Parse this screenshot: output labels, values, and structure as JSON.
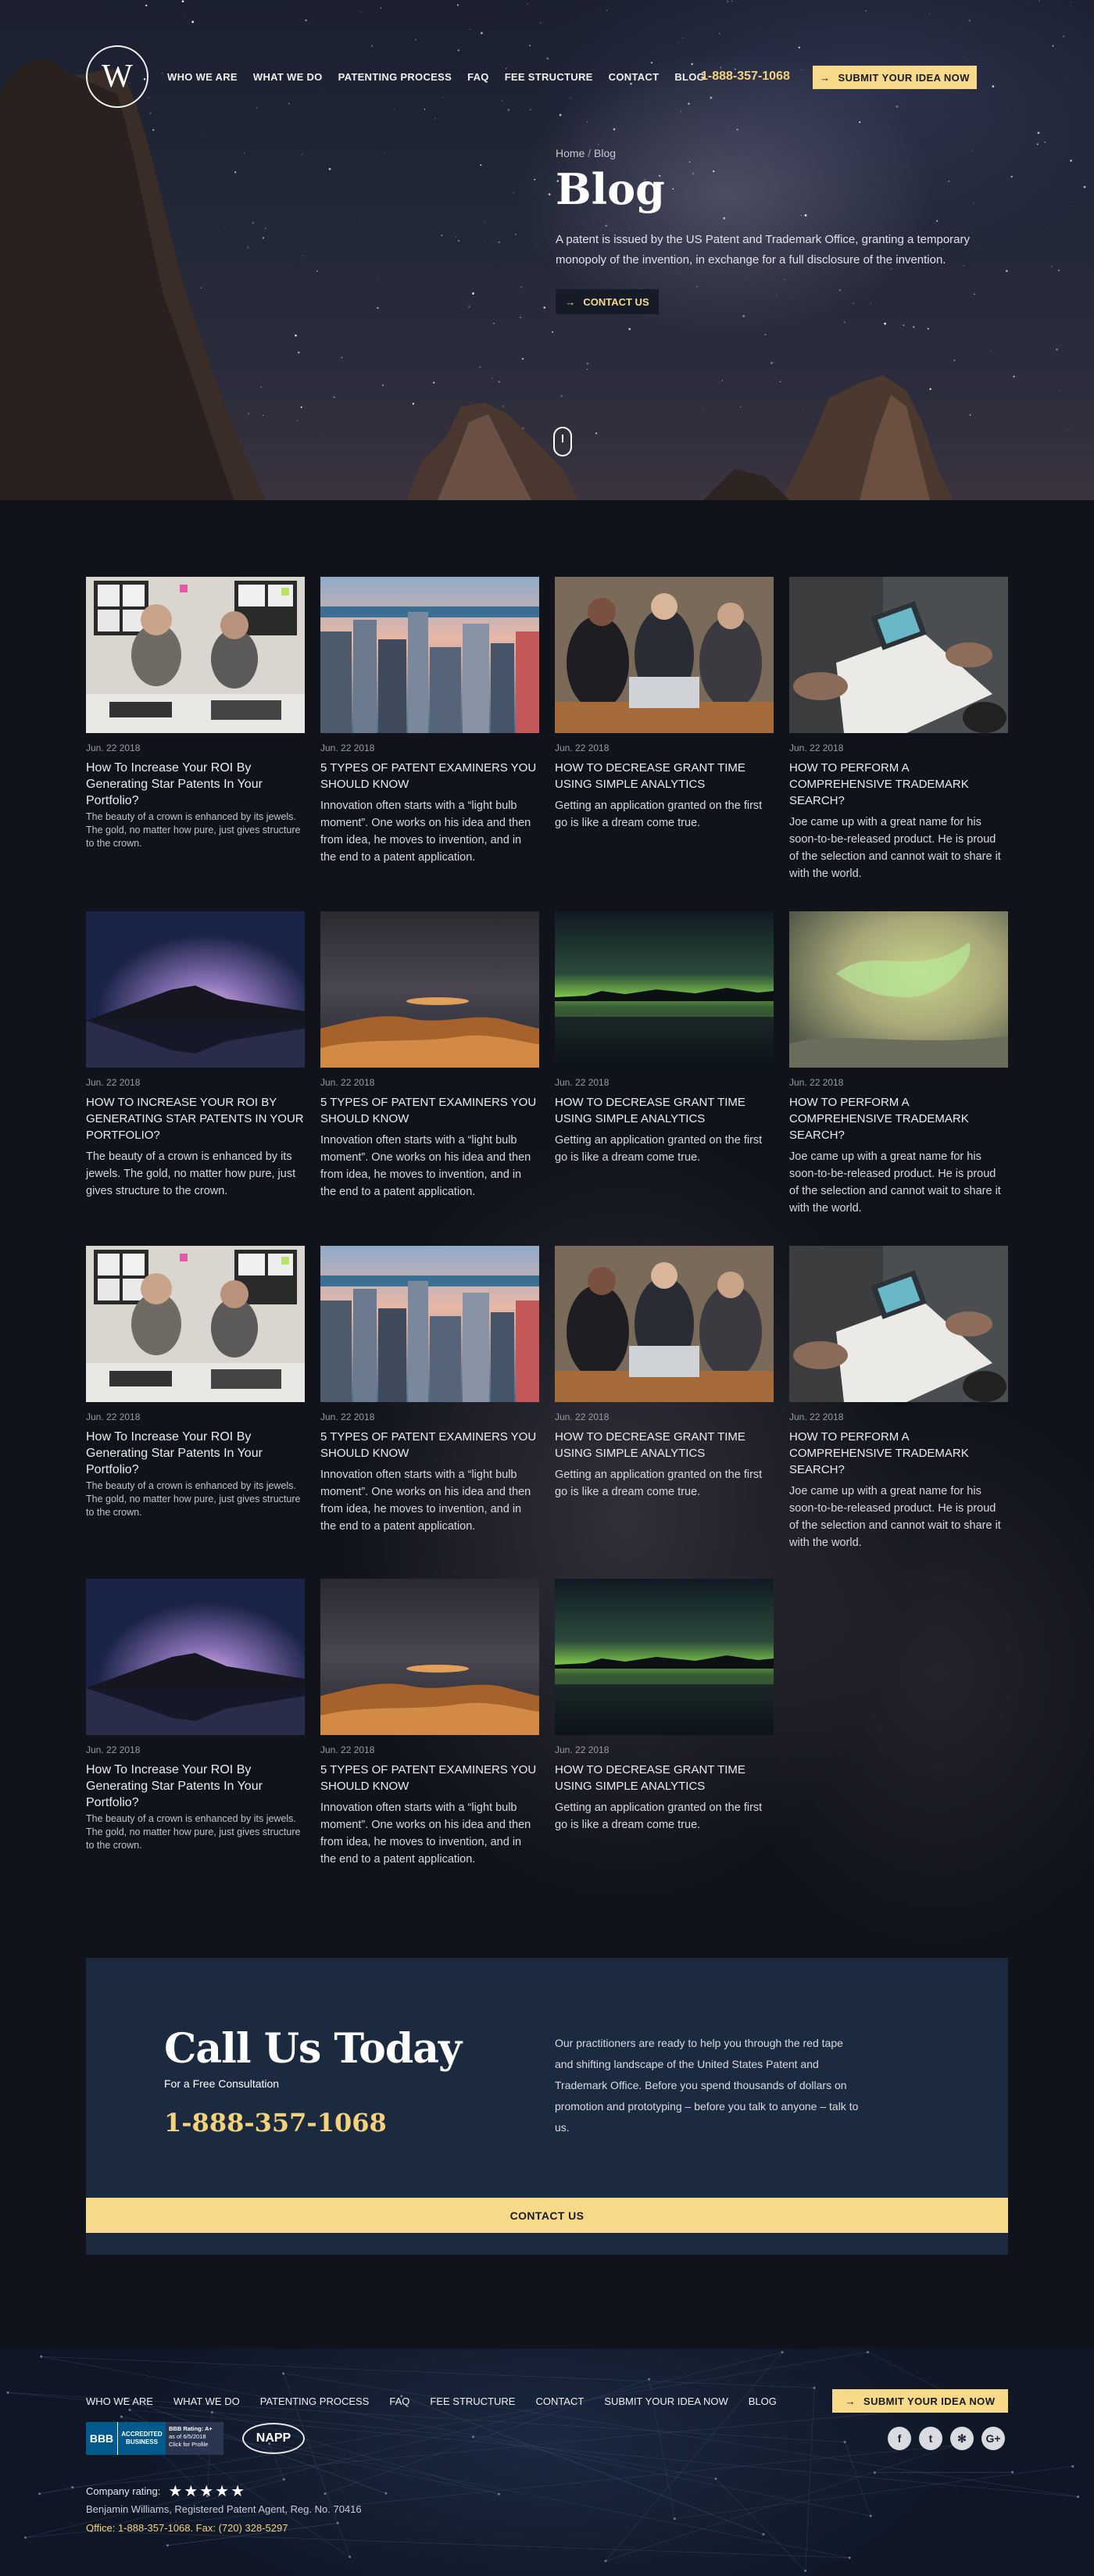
{
  "header": {
    "logo_text": "W",
    "nav": [
      "WHO WE ARE",
      "WHAT WE DO",
      "PATENTING PROCESS",
      "FAQ",
      "FEE STRUCTURE",
      "CONTACT",
      "BLOG"
    ],
    "phone": "1-888-357-1068",
    "submit_label": "SUBMIT YOUR IDEA NOW",
    "arrow": "→"
  },
  "hero": {
    "breadcrumb_home": "Home",
    "breadcrumb_sep": "/",
    "breadcrumb_current": "Blog",
    "title": "Blog",
    "description": "A patent is issued by the US Patent and Trademark Office, granting a temporary monopoly of the invention, in exchange for a full disclosure of the invention.",
    "contact_label": "CONTACT US"
  },
  "posts": [
    {
      "img": "office",
      "date": "Jun. 22 2018",
      "title": "How To Increase Your ROI By Generating Star Patents In Your Portfolio?",
      "excerpt": "The beauty of a crown is enhanced by its jewels. The gold, no matter how pure, just gives structure to the crown.",
      "style": "sentence"
    },
    {
      "img": "city",
      "date": "Jun. 22 2018",
      "title": "5 TYPES OF PATENT EXAMINERS YOU SHOULD KNOW",
      "excerpt": "Innovation often starts with a “light bulb moment”. One works on his idea and then from idea, he moves to invention, and in the end to a patent application.",
      "style": "caps"
    },
    {
      "img": "meeting",
      "date": "Jun. 22 2018",
      "title": "HOW TO DECREASE GRANT TIME USING SIMPLE ANALYTICS",
      "excerpt": "Getting an application granted on the first go is like a dream come true.",
      "style": "caps"
    },
    {
      "img": "desk",
      "date": "Jun. 22 2018",
      "title": "HOW TO PERFORM A COMPREHENSIVE TRADEMARK SEARCH?",
      "excerpt": "Joe came up with a great name for his soon-to-be-released product. He is proud of the selection and cannot wait to share it with the world.",
      "style": "caps"
    },
    {
      "img": "lake",
      "date": "Jun. 22 2018",
      "title": "HOW TO INCREASE YOUR ROI BY GENERATING STAR PATENTS IN YOUR PORTFOLIO?",
      "excerpt": "The beauty of a crown is enhanced by its jewels. The gold, no matter how pure, just gives structure to the crown.",
      "style": "caps"
    },
    {
      "img": "desert",
      "date": "Jun. 22 2018",
      "title": "5 TYPES OF PATENT EXAMINERS YOU SHOULD KNOW",
      "excerpt": "Innovation often starts with a “light bulb moment”. One works on his idea and then from idea, he moves to invention, and in the end to a patent application.",
      "style": "caps"
    },
    {
      "img": "aurora",
      "date": "Jun. 22 2018",
      "title": "HOW TO DECREASE GRANT TIME USING SIMPLE ANALYTICS",
      "excerpt": "Getting an application granted on the first go is like a dream come true.",
      "style": "caps"
    },
    {
      "img": "aurora-sky",
      "date": "Jun. 22 2018",
      "title": "HOW TO PERFORM A COMPREHENSIVE TRADEMARK SEARCH?",
      "excerpt": "Joe came up with a great name for his soon-to-be-released product. He is proud of the selection and cannot wait to share it with the world.",
      "style": "caps"
    },
    {
      "img": "office",
      "date": "Jun. 22 2018",
      "title": "How To Increase Your ROI By Generating Star Patents In Your Portfolio?",
      "excerpt": "The beauty of a crown is enhanced by its jewels. The gold, no matter how pure, just gives structure to the crown.",
      "style": "sentence"
    },
    {
      "img": "city",
      "date": "Jun. 22 2018",
      "title": "5 TYPES OF PATENT EXAMINERS YOU SHOULD KNOW",
      "excerpt": "Innovation often starts with a “light bulb moment”. One works on his idea and then from idea, he moves to invention, and in the end to a patent application.",
      "style": "caps"
    },
    {
      "img": "meeting",
      "date": "Jun. 22 2018",
      "title": "HOW TO DECREASE GRANT TIME USING SIMPLE ANALYTICS",
      "excerpt": "Getting an application granted on the first go is like a dream come true.",
      "style": "caps"
    },
    {
      "img": "desk",
      "date": "Jun. 22 2018",
      "title": "HOW TO PERFORM A COMPREHENSIVE TRADEMARK SEARCH?",
      "excerpt": "Joe came up with a great name for his soon-to-be-released product. He is proud of the selection and cannot wait to share it with the world.",
      "style": "caps"
    },
    {
      "img": "lake",
      "date": "Jun. 22 2018",
      "title": "How To Increase Your ROI By Generating Star Patents In Your Portfolio?",
      "excerpt": "The beauty of a crown is enhanced by its jewels. The gold, no matter how pure, just gives structure to the crown.",
      "style": "sentence"
    },
    {
      "img": "desert",
      "date": "Jun. 22 2018",
      "title": "5 TYPES OF PATENT EXAMINERS YOU SHOULD KNOW",
      "excerpt": "Innovation often starts with a “light bulb moment”. One works on his idea and then from idea, he moves to invention, and in the end to a patent application.",
      "style": "caps"
    },
    {
      "img": "aurora",
      "date": "Jun. 22 2018",
      "title": "HOW TO DECREASE GRANT TIME USING SIMPLE ANALYTICS",
      "excerpt": "Getting an application granted on the first go is like a dream come true.",
      "style": "caps"
    }
  ],
  "cta": {
    "title": "Call Us Today",
    "subtitle": "For a Free Consultation",
    "phone": "1-888-357-1068",
    "text": "Our practitioners are ready to help you through the red tape and shifting landscape of the United States Patent and Trademark Office. Before you spend thousands of dollars on promotion and prototyping – before you talk to anyone – talk to us.",
    "button_label": "CONTACT US"
  },
  "footer": {
    "nav": [
      "WHO WE ARE",
      "WHAT WE DO",
      "PATENTING PROCESS",
      "FAQ",
      "FEE STRUCTURE",
      "CONTACT",
      "SUBMIT YOUR IDEA NOW",
      "BLOG"
    ],
    "submit_label": "SUBMIT YOUR IDEA NOW",
    "bbb_seal": "BBB",
    "bbb_accredited": "ACCREDITED",
    "bbb_business": "BUSINESS",
    "bbb_rating": "BBB Rating: A+",
    "bbb_date": "as of 6/5/2018",
    "bbb_click": "Click for Profile",
    "napp": "NAPP",
    "social": [
      {
        "icon": "facebook-icon",
        "glyph": "f"
      },
      {
        "icon": "twitter-icon",
        "glyph": "t"
      },
      {
        "icon": "yelp-icon",
        "glyph": "✻"
      },
      {
        "icon": "google-plus-icon",
        "glyph": "G+"
      }
    ],
    "rating_label": "Company rating:",
    "rating_stars": 5,
    "rating_glyph": "★",
    "agent": "Benjamin Williams, Registered Patent Agent, Reg. No. 70416",
    "office": "Office: 1-888-357-1068. Fax: (720) 328-5297"
  },
  "colors": {
    "gold": "#f7d98a",
    "navy": "#1c2a40",
    "page_bg": "#11131a"
  }
}
